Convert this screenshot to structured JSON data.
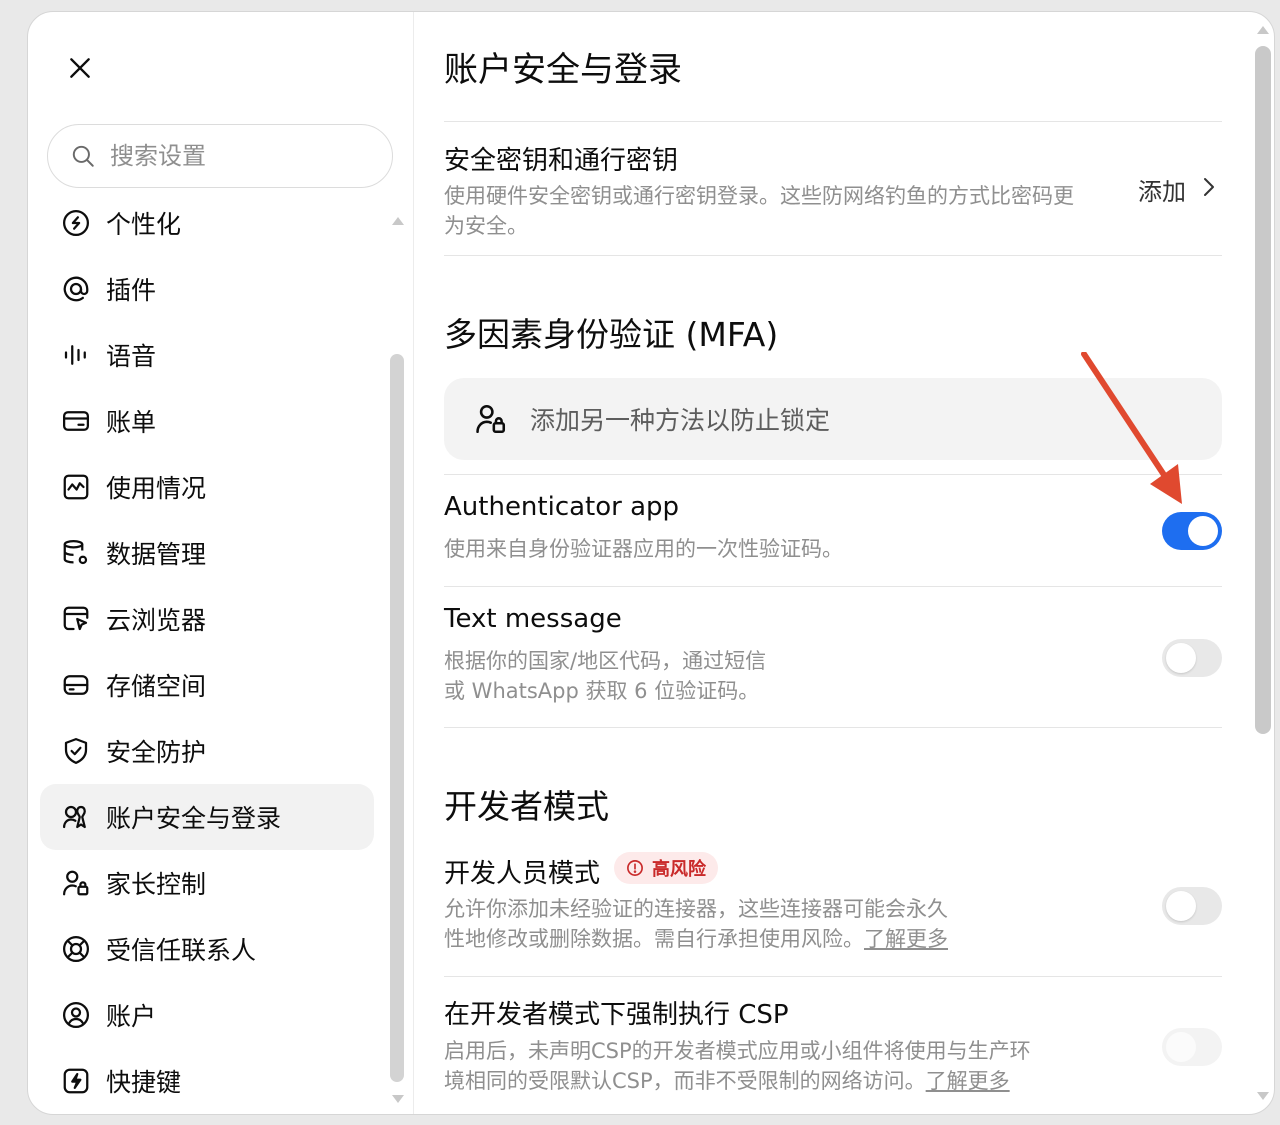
{
  "sidebar": {
    "close_icon": "close-icon",
    "search": {
      "placeholder": "搜索设置",
      "value": ""
    },
    "items": [
      {
        "label": "个性化",
        "icon": "personalization-icon"
      },
      {
        "label": "插件",
        "icon": "at-sign-icon"
      },
      {
        "label": "语音",
        "icon": "voice-wave-icon"
      },
      {
        "label": "账单",
        "icon": "credit-card-icon"
      },
      {
        "label": "使用情况",
        "icon": "usage-chart-icon"
      },
      {
        "label": "数据管理",
        "icon": "database-gear-icon"
      },
      {
        "label": "云浏览器",
        "icon": "cloud-browser-icon"
      },
      {
        "label": "存储空间",
        "icon": "storage-drive-icon"
      },
      {
        "label": "安全防护",
        "icon": "shield-check-icon"
      },
      {
        "label": "账户安全与登录",
        "icon": "account-security-icon",
        "active": true
      },
      {
        "label": "家长控制",
        "icon": "parental-control-icon"
      },
      {
        "label": "受信任联系人",
        "icon": "lifebuoy-icon"
      },
      {
        "label": "账户",
        "icon": "user-circle-icon"
      },
      {
        "label": "快捷键",
        "icon": "shortcut-icon"
      }
    ]
  },
  "main": {
    "title": "账户安全与登录",
    "passkeys": {
      "title": "安全密钥和通行密钥",
      "desc_line1": "使用硬件安全密钥或通行密钥登录。这些防网络钓鱼的方式比密码更",
      "desc_line2": "为安全。",
      "action": "添加"
    },
    "mfa": {
      "section_title": "多因素身份验证 (MFA)",
      "banner": "添加另一种方法以防止锁定",
      "authenticator": {
        "title": "Authenticator app",
        "desc": "使用来自身份验证器应用的一次性验证码。",
        "enabled": true
      },
      "sms": {
        "title": "Text message",
        "desc_line1": "根据你的国家/地区代码，通过短信",
        "desc_line2": "或 WhatsApp 获取 6 位验证码。",
        "enabled": false
      }
    },
    "developer": {
      "section_title": "开发者模式",
      "dev_mode": {
        "title": "开发人员模式",
        "badge": "高风险",
        "desc_line1": "允许你添加未经验证的连接器，这些连接器可能会永久",
        "desc_line2_prefix": "性地修改或删除数据。需自行承担使用风险。",
        "learn_more": "了解更多",
        "enabled": false
      },
      "csp": {
        "title": "在开发者模式下强制执行 CSP",
        "desc_line1": "启用后，未声明CSP的开发者模式应用或小组件将使用与生产环",
        "desc_line2_prefix": "境相同的受限默认CSP，而非不受限制的网络访问。",
        "learn_more": "了解更多",
        "enabled": false,
        "disabled": true
      }
    }
  },
  "colors": {
    "accent": "#1e6ef0",
    "risk": "#c92a2a",
    "annotation": "#e0492f"
  }
}
